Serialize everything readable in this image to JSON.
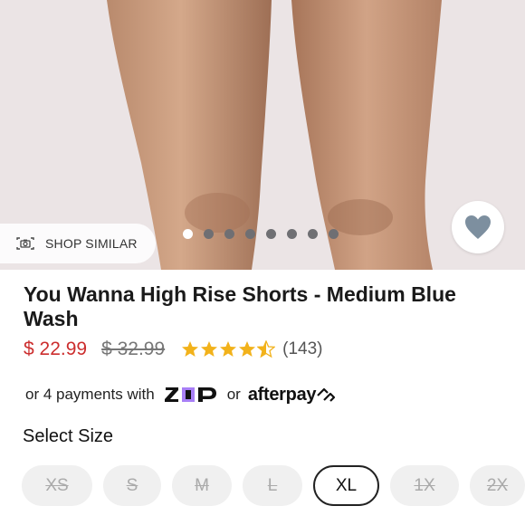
{
  "hero": {
    "shop_similar_label": "SHOP SIMILAR",
    "camera_icon": "camera-icon",
    "favorite_icon": "heart-icon",
    "carousel": {
      "count": 8,
      "active_index": 0
    }
  },
  "product": {
    "title": "You Wanna High Rise Shorts - Medium Blue Wash",
    "price": "$ 22.99",
    "original_price": "$ 32.99",
    "rating": 4.5,
    "review_count": "(143)"
  },
  "payment": {
    "prefix": "or 4 payments with",
    "zip_logo": "ZIP",
    "or_text": "or",
    "afterpay_logo": "afterpay"
  },
  "size_section": {
    "label": "Select Size",
    "sizes": [
      {
        "label": "XS",
        "available": false,
        "selected": false
      },
      {
        "label": "S",
        "available": false,
        "selected": false
      },
      {
        "label": "M",
        "available": false,
        "selected": false
      },
      {
        "label": "L",
        "available": false,
        "selected": false
      },
      {
        "label": "XL",
        "available": true,
        "selected": true
      },
      {
        "label": "1X",
        "available": false,
        "selected": false
      },
      {
        "label": "2X",
        "available": false,
        "selected": false
      }
    ]
  },
  "colors": {
    "price_red": "#cc2e2e",
    "star_gold": "#f2b21b",
    "heart_gray": "#7d8f9f",
    "zip_purple": "#a87ff6"
  }
}
